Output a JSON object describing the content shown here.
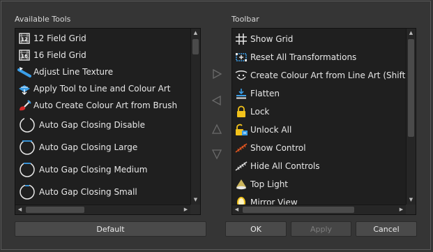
{
  "available": {
    "caption": "Available Tools",
    "items": [
      {
        "label": "12 Field Grid",
        "icon": "field-grid-12-icon"
      },
      {
        "label": "16 Field Grid",
        "icon": "field-grid-16-icon"
      },
      {
        "label": "Adjust Line Texture",
        "icon": "line-texture-icon"
      },
      {
        "label": "Apply Tool to Line and Colour Art",
        "icon": "apply-tool-icon"
      },
      {
        "label": "Auto Create Colour Art from Brush",
        "icon": "colour-brush-icon"
      },
      {
        "label": "Auto Gap Closing Disable",
        "icon": "gap-closing-disable-icon"
      },
      {
        "label": "Auto Gap Closing Large",
        "icon": "gap-closing-large-icon"
      },
      {
        "label": "Auto Gap Closing Medium",
        "icon": "gap-closing-medium-icon"
      },
      {
        "label": "Auto Gap Closing Small",
        "icon": "gap-closing-small-icon"
      }
    ]
  },
  "toolbar": {
    "caption": "Toolbar",
    "items": [
      {
        "label": "Show Grid",
        "icon": "grid-icon"
      },
      {
        "label": "Reset All Transformations",
        "icon": "reset-transform-icon"
      },
      {
        "label": "Create Colour Art from Line Art (Shift Click",
        "icon": "colour-art-icon"
      },
      {
        "label": "Flatten",
        "icon": "flatten-icon"
      },
      {
        "label": "Lock",
        "icon": "lock-icon"
      },
      {
        "label": "Unlock All",
        "icon": "unlock-all-icon"
      },
      {
        "label": "Show Control",
        "icon": "show-control-icon"
      },
      {
        "label": "Hide All Controls",
        "icon": "hide-controls-icon"
      },
      {
        "label": "Top Light",
        "icon": "top-light-icon"
      },
      {
        "label": "Mirror View",
        "icon": "mirror-view-icon"
      }
    ]
  },
  "transfer_arrows": [
    "arrow-right-icon",
    "arrow-left-icon",
    "arrow-up-icon",
    "arrow-down-icon"
  ],
  "buttons": {
    "default": "Default",
    "ok": "OK",
    "apply": "Apply",
    "cancel": "Cancel"
  },
  "colors": {
    "background": "#353535",
    "list_bg": "#1f1f1f",
    "accent_blue": "#3a9ee8",
    "lock_yellow": "#f2c21b"
  }
}
